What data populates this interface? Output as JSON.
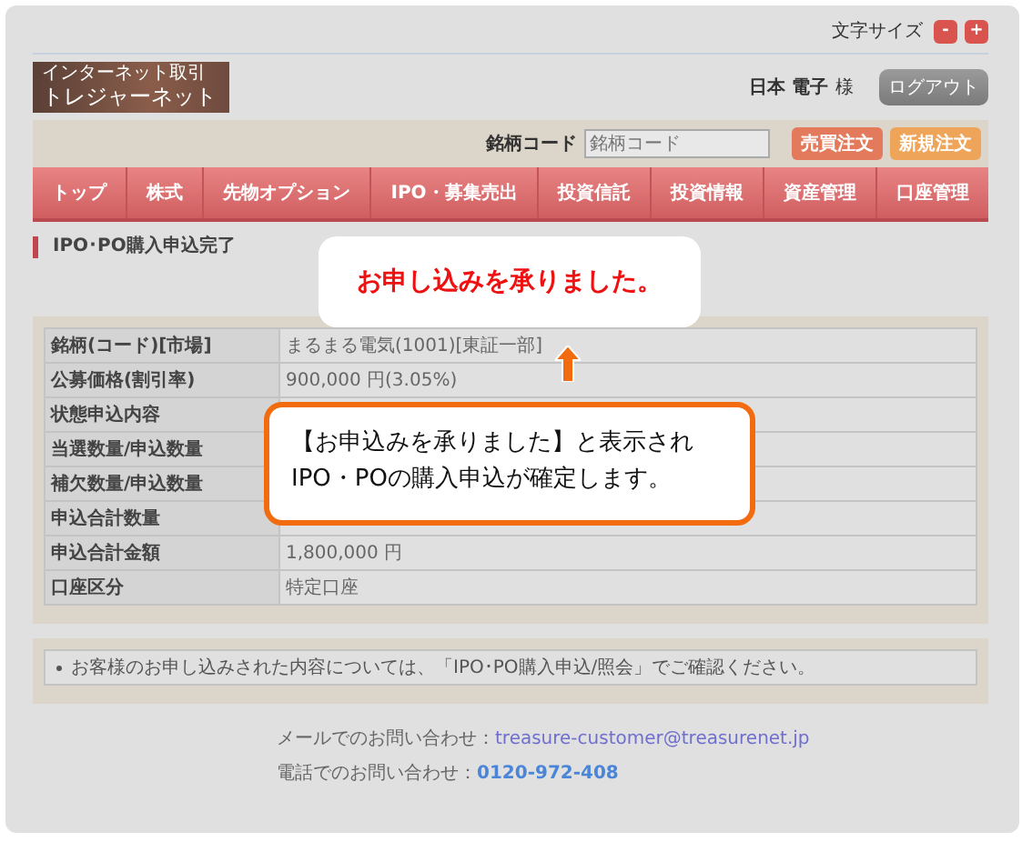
{
  "header": {
    "font_size_label": "文字サイズ",
    "font_size_buttons": [
      "-",
      "+"
    ],
    "logo_small": "インターネット取引",
    "logo": "トレジャーネット",
    "user_name": "日本 電子",
    "user_suffix": "様",
    "logout": "ログアウト"
  },
  "search": {
    "label": "銘柄コード",
    "placeholder": "銘柄コード",
    "buttons": [
      {
        "label": "売買注文",
        "kind": "trade"
      },
      {
        "label": "新規注文",
        "kind": "new"
      }
    ]
  },
  "nav": [
    "トップ",
    "株式",
    "先物オプション",
    "IPO・募集売出",
    "投資信託",
    "投資情報",
    "資産管理",
    "口座管理"
  ],
  "section_title": "IPO･PO購入申込完了",
  "table": {
    "rows": [
      {
        "label": "銘柄(コード)[市場]",
        "value": "まるまる電気(1001)[東証一部]"
      },
      {
        "label": "公募価格(割引率)",
        "value": "900,000 円(3.05%)"
      },
      {
        "label": "状態申込内容"
      },
      {
        "label": "当選数量/申込数量"
      },
      {
        "label": "補欠数量/申込数量"
      },
      {
        "label": "申込合計数量"
      },
      {
        "label": "申込合計金額",
        "value": "1,800,000 円"
      },
      {
        "label": "口座区分",
        "value": "特定口座"
      }
    ]
  },
  "notice": "お客様のお申し込みされた内容については、「IPO･PO購入申込/照会」でご確認ください。",
  "footer": [
    {
      "label": "メールでのお問い合わせ：",
      "value": "treasure-customer@treasurenet.jp",
      "kind": "mail"
    },
    {
      "label": "電話でのお問い合わせ：",
      "value": "0120-972-408",
      "kind": "phone"
    }
  ],
  "callouts": [
    {
      "text": "お申し込みを承りました。",
      "kind": "headline"
    },
    {
      "text": "【お申込みを承りました】と表示され\nIPO・POの購入申込が確定します。",
      "kind": "note"
    }
  ]
}
